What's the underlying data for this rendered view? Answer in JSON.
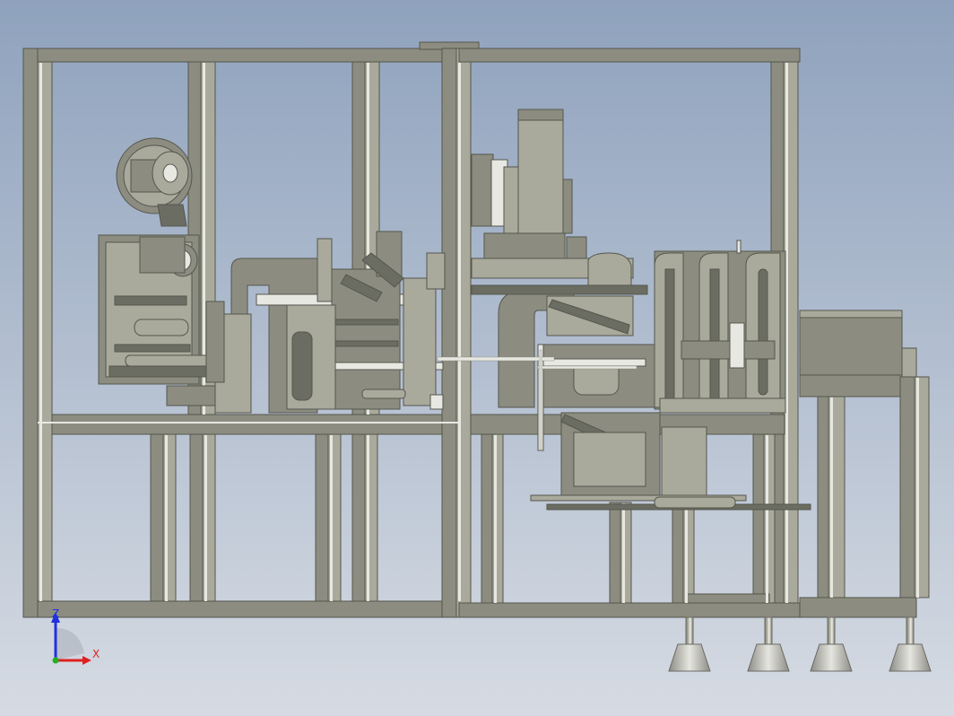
{
  "viewport": {
    "background_top": "#8fa2bd",
    "background_bottom": "#d6dbe3",
    "model_color": "#8c8d80",
    "model_light": "#a9aa9c",
    "model_dark": "#6c6d62",
    "highlight_color": "#e8e8e2",
    "foot_color": "#c9c9c2"
  },
  "triad": {
    "x_label": "X",
    "z_label": "Z",
    "x_color": "#e02020",
    "z_color": "#2030e0",
    "y_color": "#20b020"
  }
}
